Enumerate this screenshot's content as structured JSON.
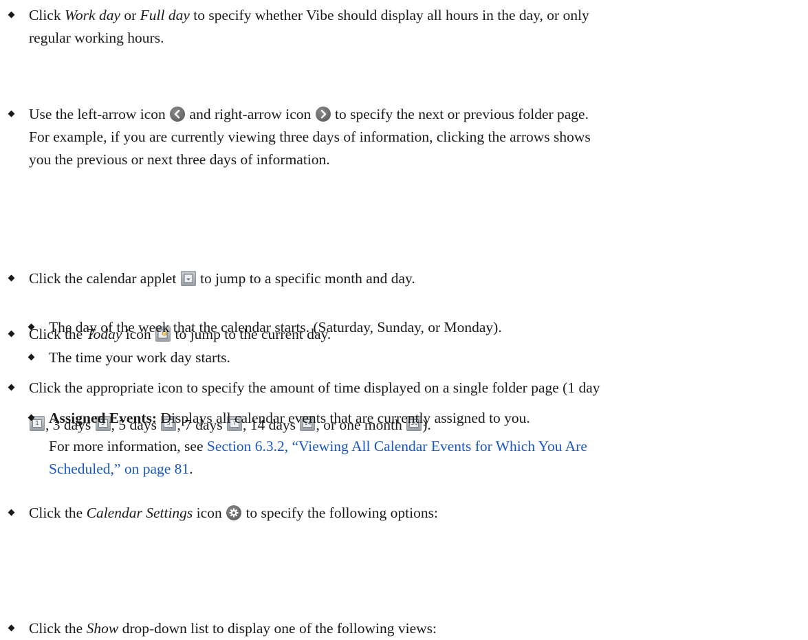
{
  "bullets": [
    {
      "parts": [
        "Click ",
        "Work day",
        " or ",
        "Full day",
        " to specify whether Vibe should display all hours in the day, or only",
        "regular working hours."
      ]
    },
    {
      "parts": [
        "Use the left-arrow icon ",
        " and right-arrow icon ",
        " to specify the next or previous folder page.",
        "For example, if you are currently viewing three days of information, clicking the arrows shows",
        "you the previous or next three days of information."
      ],
      "icons": [
        "left-arrow-icon",
        "right-arrow-icon"
      ]
    },
    {
      "parts": [
        "Click the calendar applet ",
        " to jump to a specific month and day."
      ],
      "icons": [
        "calendar-applet-icon"
      ]
    },
    {
      "parts": [
        "Click the ",
        "Today",
        " icon ",
        " to jump to the current day."
      ],
      "icons": [
        "today-icon"
      ]
    },
    {
      "parts": [
        "Click the appropriate icon to specify the amount of time displayed on a single folder page (1 day",
        ", 3 days ",
        ", 5 days ",
        ", 7 days ",
        ", 14 days ",
        ", or one month ",
        ")."
      ],
      "icons": [
        {
          "name": "one-day-icon",
          "label": "1"
        },
        {
          "name": "three-days-icon",
          "label": "3"
        },
        {
          "name": "five-days-icon",
          "label": "5"
        },
        {
          "name": "seven-days-icon",
          "label": "7"
        },
        {
          "name": "fourteen-days-icon",
          "label": "14"
        },
        {
          "name": "month-icon",
          "label": "30"
        }
      ]
    },
    {
      "parts": [
        "Click the ",
        "Calendar Settings",
        " icon ",
        " to specify the following options:"
      ],
      "icons": [
        "gear-icon"
      ],
      "sub": [
        "The day of the week that the calendar starts. (Saturday, Sunday, or Monday).",
        "The time your work day starts."
      ]
    },
    {
      "parts": [
        "Click the ",
        "Show",
        " drop-down list to display one of the following views:"
      ],
      "sub": [
        {
          "bold": "Assigned Events:",
          "text": " Displays all calendar events that are currently assigned to you.",
          "note": "For more information, see ",
          "link": "Section 6.3.2, “Viewing All Calendar Events for Which You Are",
          "link2": "Scheduled,” on page 81",
          "end": "."
        }
      ]
    }
  ],
  "colors": {
    "text": "#1a1a1a",
    "link": "#1a57c4",
    "icon_gray": "#666666"
  }
}
